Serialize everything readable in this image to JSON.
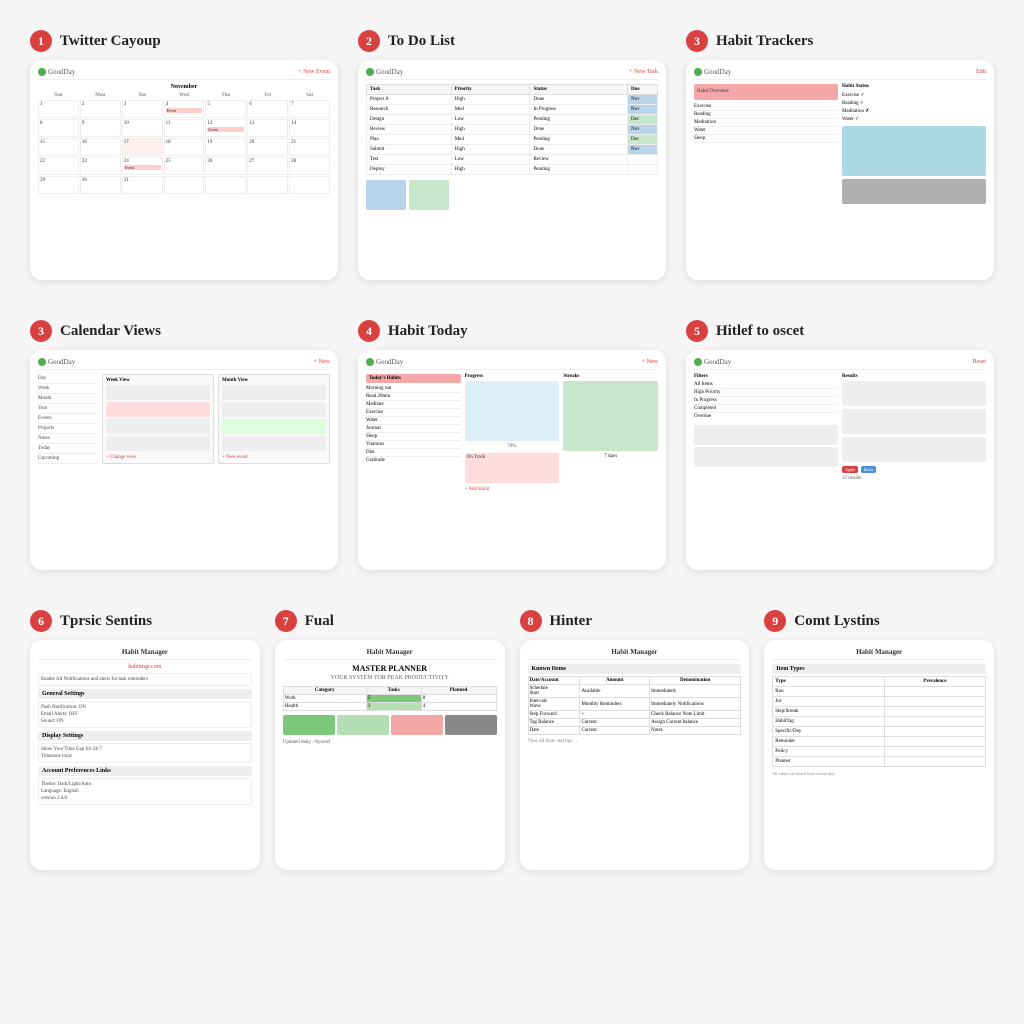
{
  "items_row1": [
    {
      "number": "1",
      "title": "Twitter Cayoup",
      "type": "calendar"
    },
    {
      "number": "2",
      "title": "To Do List",
      "type": "todo"
    },
    {
      "number": "3",
      "title": "Habit Trackers",
      "type": "habit"
    }
  ],
  "items_row2": [
    {
      "number": "3",
      "title": "Calendar Views",
      "type": "calendar-views"
    },
    {
      "number": "4",
      "title": "Habit Today",
      "type": "habit-today"
    },
    {
      "number": "5",
      "title": "Hitlef to oscet",
      "type": "filter-reset"
    }
  ],
  "items_row3": [
    {
      "number": "6",
      "title": "Tprsic Sentins",
      "type": "topic-settings"
    },
    {
      "number": "7",
      "title": "Fual",
      "type": "full"
    },
    {
      "number": "8",
      "title": "Hinter",
      "type": "hints"
    },
    {
      "number": "9",
      "title": "Comt Lystins",
      "type": "count-listings"
    }
  ],
  "app_name": "GoodDay",
  "calendar_days": [
    "Sun",
    "Mon",
    "Tue",
    "Wed",
    "Thu",
    "Fri",
    "Sat"
  ],
  "calendar_weeks": [
    [
      "1",
      "2",
      "3",
      "4",
      "5",
      "6",
      "7"
    ],
    [
      "8",
      "9",
      "10",
      "11",
      "12",
      "13",
      "14"
    ],
    [
      "15",
      "16",
      "17",
      "18",
      "19",
      "20",
      "21"
    ],
    [
      "22",
      "23",
      "24",
      "25",
      "26",
      "27",
      "28"
    ],
    [
      "29",
      "30",
      "31",
      "",
      "",
      "",
      ""
    ]
  ]
}
